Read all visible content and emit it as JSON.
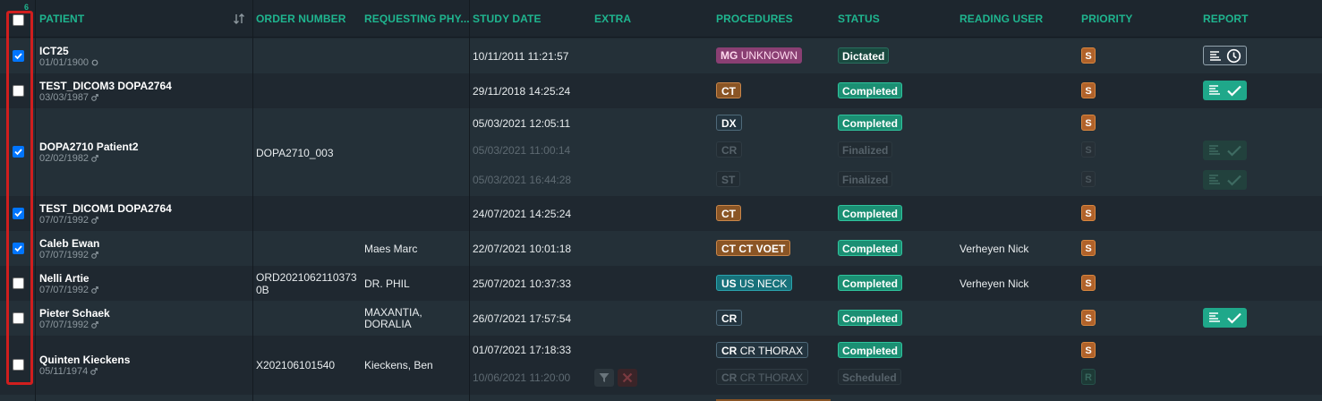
{
  "header": {
    "selected_count": "6",
    "columns": {
      "patient": "PATIENT",
      "order_number": "ORDER NUMBER",
      "requesting_physician": "REQUESTING PHY...",
      "study_date": "STUDY DATE",
      "extra": "EXTRA",
      "procedures": "PROCEDURES",
      "status": "STATUS",
      "reading_user": "READING USER",
      "priority": "PRIORITY",
      "report": "REPORT"
    }
  },
  "colors": {
    "accent": "#1fb58f",
    "completed": "#1b8f73",
    "priority_s": "#b0622a",
    "highlight_frame": "#d01e1e",
    "checkbox_checked": "#0075ff"
  },
  "rows": [
    {
      "checked": true,
      "name": "ICT25",
      "dob": "01/01/1900",
      "gender": "unknown",
      "order_number": "",
      "physician": "",
      "studies": [
        {
          "date": "10/11/2011 11:21:57",
          "proc_mod": "MG",
          "proc_desc": "UNKNOWN",
          "status": "Dictated",
          "priority": "S",
          "report": "pending"
        }
      ],
      "reading_user": ""
    },
    {
      "checked": false,
      "name": "TEST_DICOM3 DOPA2764",
      "dob": "03/03/1987",
      "gender": "male",
      "order_number": "",
      "physician": "",
      "studies": [
        {
          "date": "29/11/2018 14:25:24",
          "proc_mod": "CT",
          "proc_desc": "",
          "status": "Completed",
          "priority": "S",
          "report": "done"
        }
      ],
      "reading_user": ""
    },
    {
      "checked": true,
      "name": "DOPA2710 Patient2",
      "dob": "02/02/1982",
      "gender": "male",
      "order_number": "DOPA2710_003",
      "physician": "",
      "studies": [
        {
          "date": "05/03/2021 12:05:11",
          "proc_mod": "DX",
          "proc_desc": "",
          "status": "Completed",
          "priority": "S",
          "report": ""
        },
        {
          "date": "05/03/2021 11:00:14",
          "proc_mod": "CR",
          "proc_desc": "",
          "status": "Finalized",
          "priority": "S",
          "report": "done-dim"
        },
        {
          "date": "05/03/2021 16:44:28",
          "proc_mod": "ST",
          "proc_desc": "",
          "status": "Finalized",
          "priority": "S",
          "report": "done-dim"
        }
      ],
      "reading_user": ""
    },
    {
      "checked": true,
      "name": "TEST_DICOM1 DOPA2764",
      "dob": "07/07/1992",
      "gender": "male",
      "order_number": "",
      "physician": "",
      "studies": [
        {
          "date": "24/07/2021 14:25:24",
          "proc_mod": "CT",
          "proc_desc": "",
          "status": "Completed",
          "priority": "S",
          "report": ""
        }
      ],
      "reading_user": ""
    },
    {
      "checked": true,
      "name": "Caleb Ewan",
      "dob": "07/07/1992",
      "gender": "male",
      "order_number": "",
      "physician": "Maes Marc",
      "studies": [
        {
          "date": "22/07/2021 10:01:18",
          "proc_mod": "CT",
          "proc_desc": "CT VOET",
          "status": "Completed",
          "priority": "S",
          "report": ""
        }
      ],
      "reading_user": "Verheyen Nick"
    },
    {
      "checked": false,
      "name": "Nelli Artie",
      "dob": "07/07/1992",
      "gender": "male",
      "order_number_line1": "ORD2021062110373",
      "order_number_line2": "0B",
      "physician": "DR. PHIL",
      "studies": [
        {
          "date": "25/07/2021 10:37:33",
          "proc_mod": "US",
          "proc_desc": "US NECK",
          "status": "Completed",
          "priority": "S",
          "report": ""
        }
      ],
      "reading_user": "Verheyen Nick"
    },
    {
      "checked": false,
      "name": "Pieter Schaek",
      "dob": "07/07/1992",
      "gender": "male",
      "order_number": "",
      "physician_line1": "MAXANTIA,",
      "physician_line2": "DORALIA",
      "studies": [
        {
          "date": "26/07/2021 17:57:54",
          "proc_mod": "CR",
          "proc_desc": "",
          "status": "Completed",
          "priority": "S",
          "report": "done"
        }
      ],
      "reading_user": ""
    },
    {
      "checked": false,
      "name": "Quinten Kieckens",
      "dob": "05/11/1974",
      "gender": "male",
      "order_number": "X202106101540",
      "physician": "Kieckens, Ben",
      "studies": [
        {
          "date": "01/07/2021 17:18:33",
          "proc_mod": "CR",
          "proc_desc": "CR THORAX",
          "status": "Completed",
          "priority": "S",
          "report": ""
        },
        {
          "date": "10/06/2021 11:20:00",
          "proc_mod": "CR",
          "proc_desc": "CR THORAX",
          "status": "Scheduled",
          "priority": "R",
          "report": ""
        }
      ],
      "reading_user": ""
    }
  ],
  "icons": [
    "sort-icon",
    "male-icon",
    "unknown-gender-icon",
    "report-lines-icon",
    "clock-icon",
    "check-icon",
    "filter-icon",
    "close-icon"
  ]
}
